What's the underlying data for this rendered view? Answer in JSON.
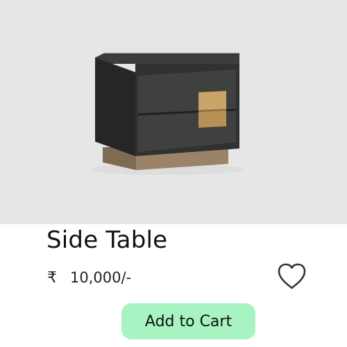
{
  "product": {
    "image_subject": "side-table-photo",
    "title": "Side Table",
    "currency_symbol": "₹",
    "price": "10,000/-"
  },
  "actions": {
    "wishlist_icon": "heart-outline-icon",
    "add_to_cart_label": "Add to Cart"
  },
  "colors": {
    "image_background": "#e6e6e6",
    "button_background": "#a7f3c1",
    "heart_stroke": "#333333"
  }
}
